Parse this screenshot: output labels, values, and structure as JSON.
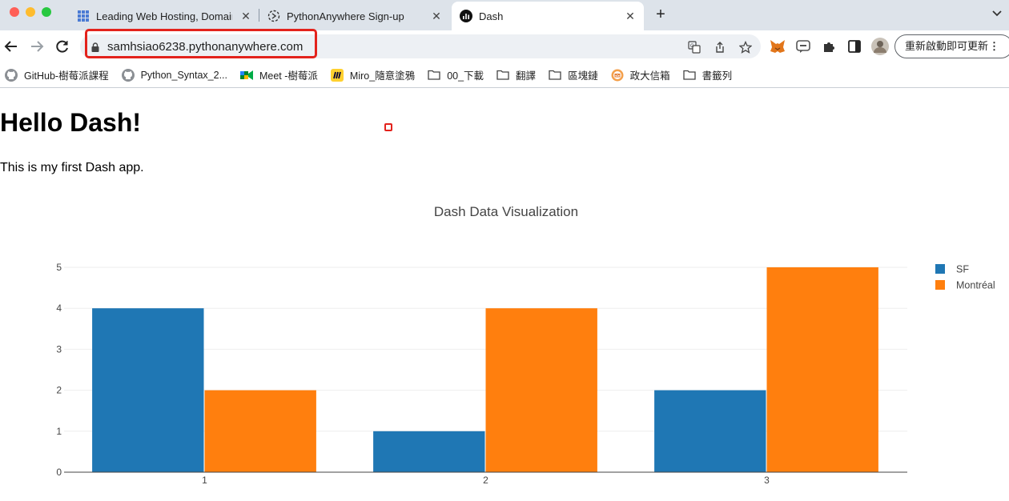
{
  "browser": {
    "tabs": [
      {
        "title": "Leading Web Hosting, Domain",
        "icon": "grid-icon",
        "active": false
      },
      {
        "title": "PythonAnywhere Sign-up",
        "icon": "pythonanywhere-icon",
        "active": false
      },
      {
        "title": "Dash",
        "icon": "dash-icon",
        "active": true
      }
    ],
    "url": "samhsiao6238.pythonanywhere.com",
    "update_button": "重新啟動即可更新",
    "update_button_more": "⋮",
    "bookmarks": [
      {
        "label": "GitHub-樹莓派課程",
        "icon": "github-icon"
      },
      {
        "label": "Python_Syntax_2...",
        "icon": "github-icon"
      },
      {
        "label": "Meet -樹莓派",
        "icon": "meet-icon"
      },
      {
        "label": "Miro_隨意塗鴉",
        "icon": "miro-icon"
      },
      {
        "label": "00_下載",
        "icon": "folder-icon"
      },
      {
        "label": "翻譯",
        "icon": "folder-icon"
      },
      {
        "label": "區塊鏈",
        "icon": "folder-icon"
      },
      {
        "label": "政大信箱",
        "icon": "mail-icon"
      },
      {
        "label": "書籤列",
        "icon": "folder-icon"
      }
    ]
  },
  "page": {
    "heading": "Hello Dash!",
    "paragraph": "This is my first Dash app."
  },
  "chart_data": {
    "type": "bar",
    "title": "Dash Data Visualization",
    "categories": [
      "1",
      "2",
      "3"
    ],
    "series": [
      {
        "name": "SF",
        "values": [
          4,
          1,
          2
        ],
        "color": "#1f77b4"
      },
      {
        "name": "Montréal",
        "values": [
          2,
          4,
          5
        ],
        "color": "#ff7f0e"
      }
    ],
    "yticks": [
      "0",
      "1",
      "2",
      "3",
      "4",
      "5"
    ],
    "ylim": [
      0,
      5
    ],
    "grid": true,
    "legend": "top-right",
    "xlabel": "",
    "ylabel": ""
  }
}
